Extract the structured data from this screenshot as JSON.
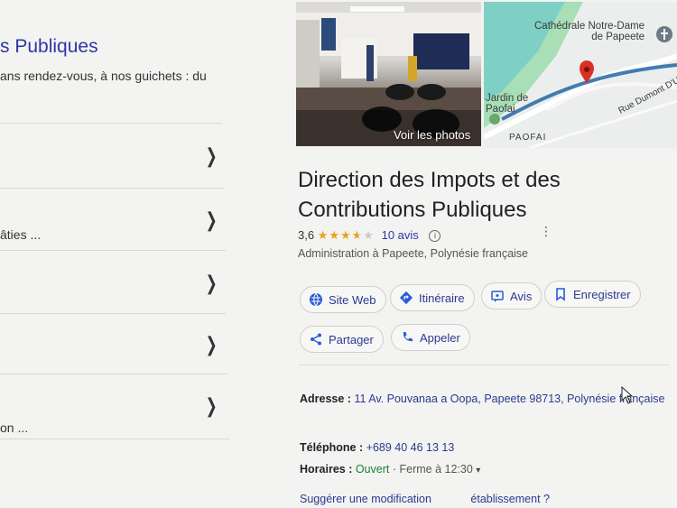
{
  "left": {
    "heading": "s Publiques",
    "snippet": "ans rendez-vous, à nos guichets : du",
    "rows": [
      {
        "text": ""
      },
      {
        "text": "âties ..."
      },
      {
        "text": ""
      },
      {
        "text": ""
      },
      {
        "text": "on ..."
      }
    ]
  },
  "panel": {
    "photo_button": "Voir les photos",
    "map_labels": {
      "cathedral": "Cathédrale Notre-Dame\nde Papeete",
      "jardin": "Jardin de\nPaofai",
      "paofai": "PAOFAI",
      "rue": "Rue Dumont D'Urv"
    },
    "title": "Direction des Impots et des Contributions Publiques",
    "rating": {
      "score": "3,6",
      "stars_value": 3.6,
      "reviews": "10 avis"
    },
    "category": "Administration à Papeete, Polynésie française",
    "buttons": {
      "site": "Site Web",
      "itineraire": "Itinéraire",
      "avis": "Avis",
      "enregistrer": "Enregistrer",
      "partager": "Partager",
      "appeler": "Appeler"
    },
    "details": {
      "address_label": "Adresse :",
      "address": "11 Av. Pouvanaa a Oopa, Papeete 98713, Polynésie française",
      "phone_label": "Téléphone :",
      "phone": "+689 40 46 13 13",
      "hours_label": "Horaires :",
      "hours_status": "Ouvert",
      "hours_close": "· Ferme à 12:30",
      "suggest": "Suggérer une modification",
      "trailing": "établissement ?"
    },
    "colors": {
      "link": "#2a3a8f",
      "star": "#e8a317",
      "open": "#1e7e34",
      "pin": "#d93025"
    }
  }
}
